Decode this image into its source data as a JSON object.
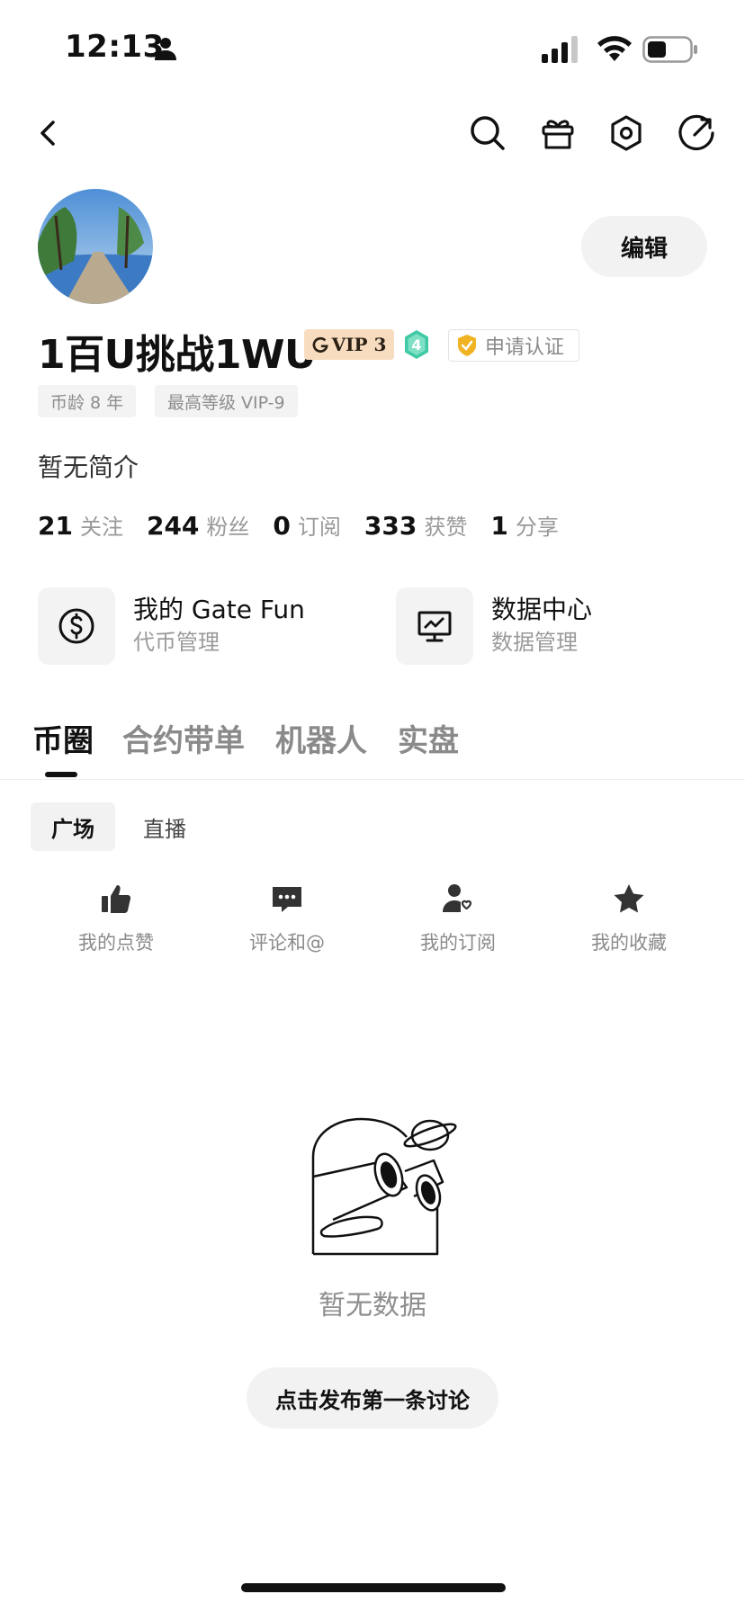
{
  "status_bar": {
    "time": "12:13"
  },
  "profile": {
    "edit_label": "编辑",
    "username": "1百U挑战1WU",
    "vip_label": "VIP 3",
    "level": "4",
    "verify_label": "申请认证",
    "tags": [
      "币龄 8 年",
      "最高等级 VIP-9"
    ],
    "bio": "暂无简介"
  },
  "stats": [
    {
      "value": "21",
      "label": "关注"
    },
    {
      "value": "244",
      "label": "粉丝"
    },
    {
      "value": "0",
      "label": "订阅"
    },
    {
      "value": "333",
      "label": "获赞"
    },
    {
      "value": "1",
      "label": "分享"
    }
  ],
  "features": [
    {
      "title": "我的 Gate Fun",
      "subtitle": "代币管理",
      "icon": "dollar-circle-icon"
    },
    {
      "title": "数据中心",
      "subtitle": "数据管理",
      "icon": "monitor-chart-icon"
    }
  ],
  "main_tabs": [
    {
      "label": "币圈",
      "active": true
    },
    {
      "label": "合约带单",
      "active": false
    },
    {
      "label": "机器人",
      "active": false
    },
    {
      "label": "实盘",
      "active": false
    }
  ],
  "sub_tabs": [
    {
      "label": "广场",
      "active": true
    },
    {
      "label": "直播",
      "active": false
    }
  ],
  "shortcuts": [
    {
      "label": "我的点赞",
      "icon": "thumbs-up-icon"
    },
    {
      "label": "评论和@",
      "icon": "comment-icon"
    },
    {
      "label": "我的订阅",
      "icon": "subscribe-user-icon"
    },
    {
      "label": "我的收藏",
      "icon": "star-icon"
    }
  ],
  "empty_state": {
    "text": "暂无数据",
    "button_label": "点击发布第一条讨论"
  },
  "colors": {
    "vip_badge_bg": "#f7dcc0",
    "level_badge": "#3fc9a5",
    "verify_icon": "#f0b323",
    "muted_text": "#9a9a9a",
    "card_bg": "#f3f3f3"
  }
}
